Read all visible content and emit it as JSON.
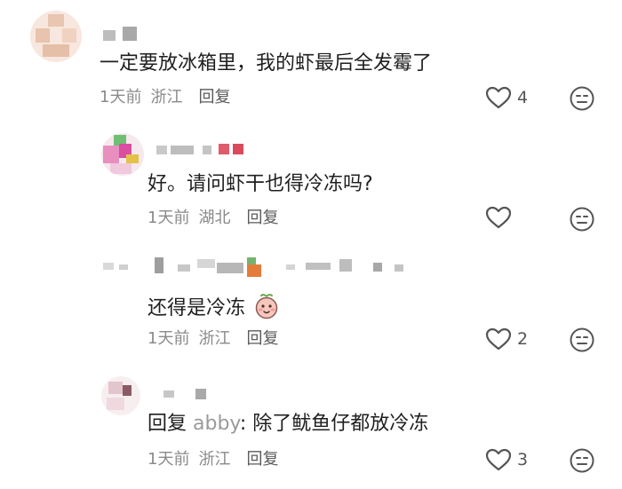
{
  "comments": [
    {
      "text": "一定要放冰箱里，我的虾最后全发霉了",
      "time": "1天前",
      "location": "浙江",
      "reply_label": "回复",
      "likes": "4"
    },
    {
      "text": "好。请问虾干也得冷冻吗?",
      "time": "1天前",
      "location": "湖北",
      "reply_label": "回复",
      "likes": ""
    },
    {
      "text": "还得是冷冻",
      "time": "1天前",
      "location": "浙江",
      "reply_label": "回复",
      "likes": "2"
    },
    {
      "text_prefix": "回复",
      "mention": "abby",
      "text_suffix": ": 除了鱿鱼仔都放冷冻",
      "time": "1天前",
      "location": "浙江",
      "reply_label": "回复",
      "likes": "3"
    }
  ],
  "icons": {
    "like": "heart-outline-icon",
    "reaction": "neutral-face-icon",
    "emoji": "peach-face-emoji"
  },
  "colors": {
    "text": "#1f1f1f",
    "meta": "#8a8a8a",
    "icon": "#555555"
  }
}
